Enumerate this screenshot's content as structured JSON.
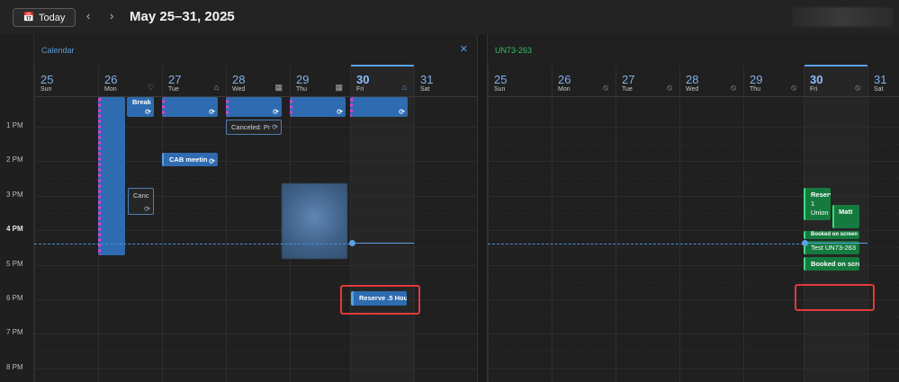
{
  "toolbar": {
    "today_label": "Today",
    "prev_icon": "chevron-left-icon",
    "next_icon": "chevron-right-icon",
    "date_range": "May 25–31, 2025",
    "range_dropdown_icon": "chevron-down-icon"
  },
  "times": [
    "1 PM",
    "2 PM",
    "3 PM",
    "4 PM",
    "5 PM",
    "6 PM",
    "7 PM",
    "8 PM"
  ],
  "left": {
    "title": "Calendar",
    "title_color": "#5b9bd5",
    "days": [
      {
        "num": "25",
        "name": "Sun",
        "icon": ""
      },
      {
        "num": "26",
        "name": "Mon",
        "icon": "heart-icon"
      },
      {
        "num": "27",
        "name": "Tue",
        "icon": "home-icon"
      },
      {
        "num": "28",
        "name": "Wed",
        "icon": "building-icon"
      },
      {
        "num": "29",
        "name": "Thu",
        "icon": "building-icon"
      },
      {
        "num": "30",
        "name": "Fri",
        "icon": "home-icon"
      },
      {
        "num": "31",
        "name": "Sat",
        "icon": ""
      }
    ],
    "events": {
      "break": "Break",
      "canceled_p": "Canceled: Pr",
      "cab": "CAB meetin",
      "canc": "Canc",
      "reserve": "Reserve .5 Hou"
    }
  },
  "right": {
    "title": "UN73-263",
    "title_color": "#2fbf60",
    "days": [
      {
        "num": "25",
        "name": "Sun",
        "icon": ""
      },
      {
        "num": "26",
        "name": "Mon",
        "icon": "location-off-icon"
      },
      {
        "num": "27",
        "name": "Tue",
        "icon": "location-off-icon"
      },
      {
        "num": "28",
        "name": "Wed",
        "icon": "location-off-icon"
      },
      {
        "num": "29",
        "name": "Thu",
        "icon": "location-off-icon"
      },
      {
        "num": "30",
        "name": "Fri",
        "icon": "location-off-icon"
      },
      {
        "num": "31",
        "name": "Sat",
        "icon": ""
      }
    ],
    "events": {
      "reserve_1": "Reserv",
      "reserve_2": "1",
      "reserve_3": "Union",
      "matt": "Matt",
      "booked_1": "Booked on screen",
      "test": "Test UN73-263",
      "booked_2": "Booked on scre"
    }
  }
}
